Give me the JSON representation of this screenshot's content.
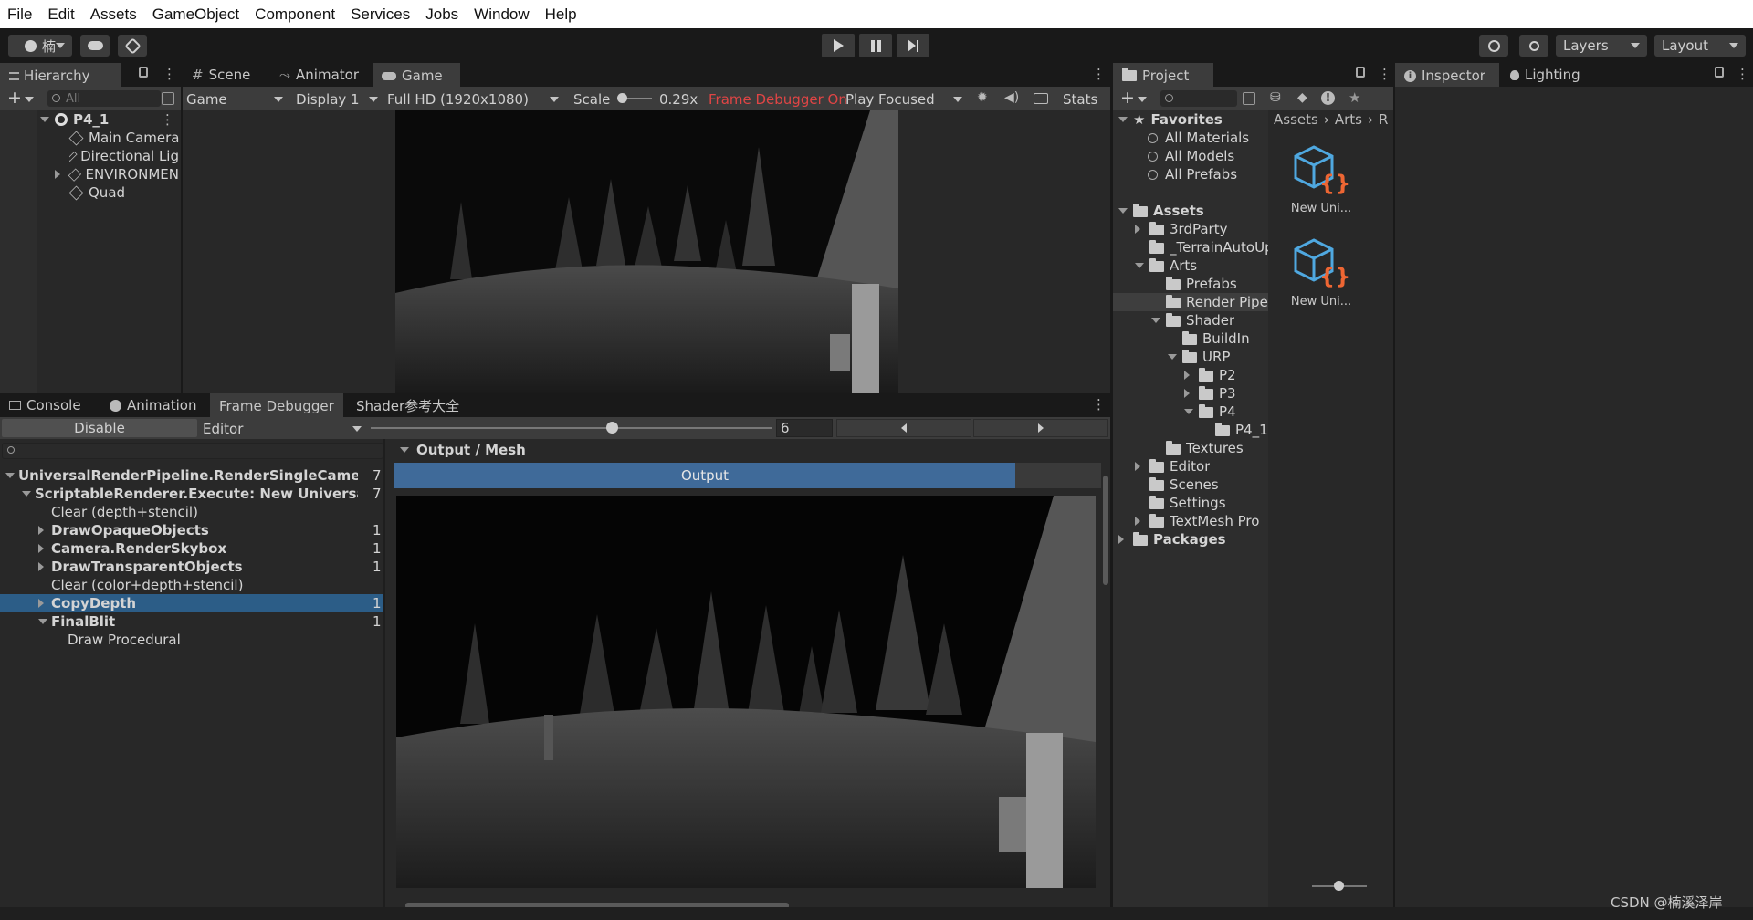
{
  "menu": [
    "File",
    "Edit",
    "Assets",
    "GameObject",
    "Component",
    "Services",
    "Jobs",
    "Window",
    "Help"
  ],
  "toolbar": {
    "account_label": "楠",
    "layers_label": "Layers",
    "layout_label": "Layout"
  },
  "hierarchy": {
    "tab_label": "Hierarchy",
    "search_placeholder": "All",
    "scene_name": "P4_1",
    "items": [
      "Main Camera",
      "Directional Lig",
      "ENVIRONMEN",
      "Quad"
    ]
  },
  "scene_tabs": [
    "Scene",
    "Animator",
    "Game"
  ],
  "game_bar": {
    "mode": "Game",
    "display": "Display 1",
    "resolution": "Full HD (1920x1080)",
    "scale_label": "Scale",
    "scale_value": "0.29x",
    "frame_debugger_flag": "Frame Debugger On",
    "play_focused": "Play Focused",
    "stats": "Stats"
  },
  "bottom_tabs": [
    "Console",
    "Animation",
    "Frame Debugger",
    "Shader参考大全"
  ],
  "frame_debugger": {
    "disable_label": "Disable",
    "target_label": "Editor",
    "event_index": "6",
    "event_slider_fraction": 0.6,
    "events": [
      {
        "label": "UniversalRenderPipeline.RenderSingleCameraIntern",
        "count": "7",
        "bold": true,
        "indent": 0,
        "arrow": "down"
      },
      {
        "label": "ScriptableRenderer.Execute: New Universal Rendi",
        "count": "7",
        "bold": true,
        "indent": 1,
        "arrow": "down"
      },
      {
        "label": "Clear (depth+stencil)",
        "count": "",
        "bold": false,
        "indent": 2,
        "arrow": ""
      },
      {
        "label": "DrawOpaqueObjects",
        "count": "1",
        "bold": true,
        "indent": 2,
        "arrow": "right"
      },
      {
        "label": "Camera.RenderSkybox",
        "count": "1",
        "bold": true,
        "indent": 2,
        "arrow": "right"
      },
      {
        "label": "DrawTransparentObjects",
        "count": "1",
        "bold": true,
        "indent": 2,
        "arrow": "right"
      },
      {
        "label": "Clear (color+depth+stencil)",
        "count": "",
        "bold": false,
        "indent": 2,
        "arrow": ""
      },
      {
        "label": "CopyDepth",
        "count": "1",
        "bold": true,
        "indent": 2,
        "arrow": "right",
        "selected": true
      },
      {
        "label": "FinalBlit",
        "count": "1",
        "bold": true,
        "indent": 2,
        "arrow": "down"
      },
      {
        "label": "Draw Procedural",
        "count": "",
        "bold": false,
        "indent": 3,
        "arrow": ""
      }
    ],
    "detail_header": "Output / Mesh",
    "output_tab": "Output"
  },
  "project": {
    "tab_label": "Project",
    "favorites_label": "Favorites",
    "favorites": [
      "All Materials",
      "All Models",
      "All Prefabs"
    ],
    "breadcrumb": [
      "Assets",
      "Arts",
      "R"
    ],
    "tree": [
      {
        "label": "Assets",
        "indent": 0,
        "bold": true,
        "arrow": "down"
      },
      {
        "label": "3rdParty",
        "indent": 1,
        "arrow": "right"
      },
      {
        "label": "_TerrainAutoUp",
        "indent": 1,
        "arrow": ""
      },
      {
        "label": "Arts",
        "indent": 1,
        "arrow": "down"
      },
      {
        "label": "Prefabs",
        "indent": 2,
        "arrow": ""
      },
      {
        "label": "Render Pipeli",
        "indent": 2,
        "arrow": "",
        "selected": true
      },
      {
        "label": "Shader",
        "indent": 2,
        "arrow": "down"
      },
      {
        "label": "BuildIn",
        "indent": 3,
        "arrow": ""
      },
      {
        "label": "URP",
        "indent": 3,
        "arrow": "down"
      },
      {
        "label": "P2",
        "indent": 4,
        "arrow": "right"
      },
      {
        "label": "P3",
        "indent": 4,
        "arrow": "right"
      },
      {
        "label": "P4",
        "indent": 4,
        "arrow": "down"
      },
      {
        "label": "P4_1",
        "indent": 5,
        "arrow": ""
      },
      {
        "label": "Textures",
        "indent": 2,
        "arrow": ""
      },
      {
        "label": "Editor",
        "indent": 1,
        "arrow": "right"
      },
      {
        "label": "Scenes",
        "indent": 1,
        "arrow": ""
      },
      {
        "label": "Settings",
        "indent": 1,
        "arrow": ""
      },
      {
        "label": "TextMesh Pro",
        "indent": 1,
        "arrow": "right"
      },
      {
        "label": "Packages",
        "indent": 0,
        "bold": true,
        "arrow": "right"
      }
    ],
    "assets": [
      "New Uni...",
      "New Uni..."
    ]
  },
  "inspector": {
    "tabs": [
      "Inspector",
      "Lighting"
    ]
  },
  "watermark": "CSDN @楠溪泽岸",
  "colors": {
    "selection": "#2c5d87",
    "output_tab": "#3f6a99",
    "frame_debugger_red": "#e04545"
  }
}
